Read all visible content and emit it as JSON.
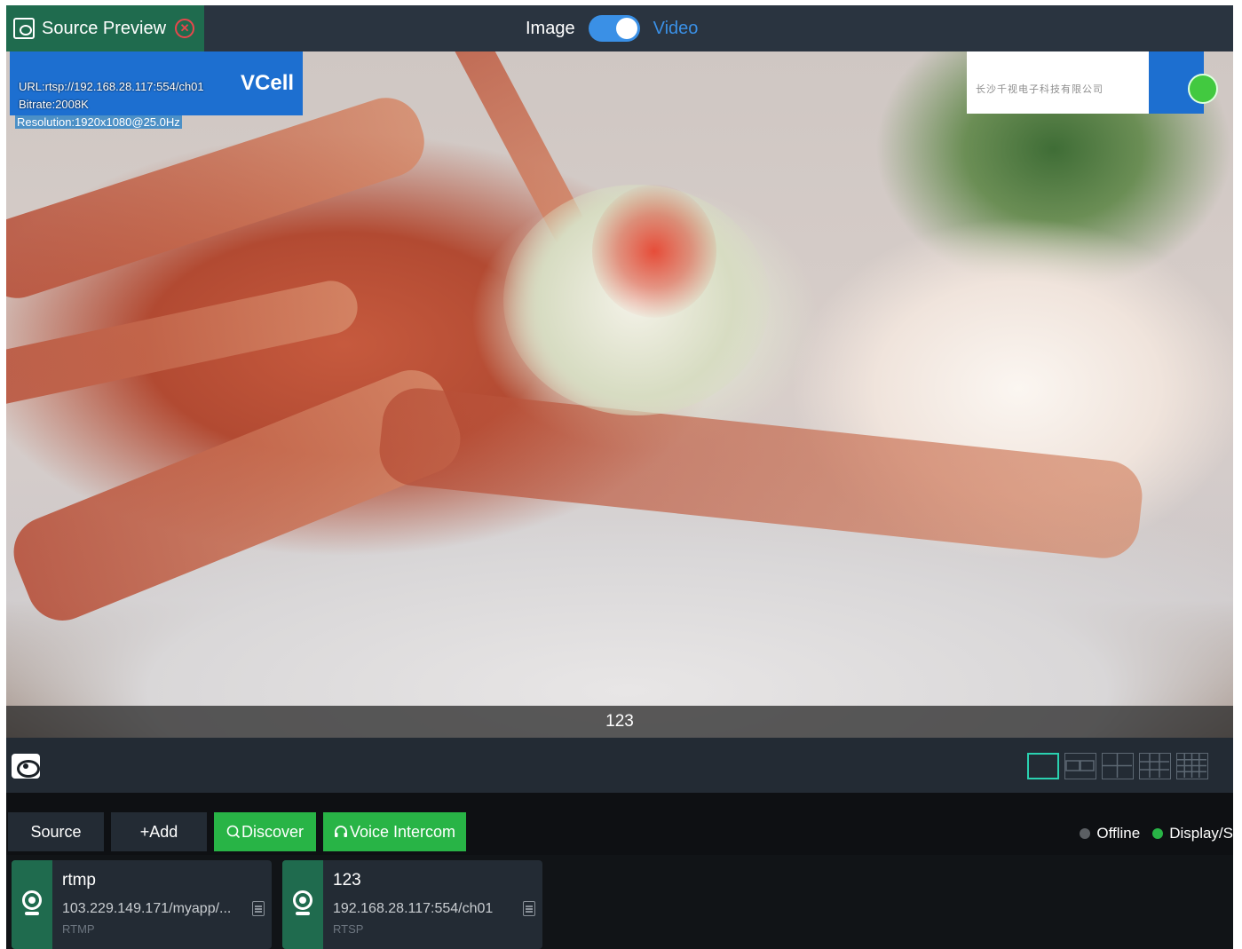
{
  "header": {
    "title": "Source Preview",
    "toggle_left": "Image",
    "toggle_right": "Video",
    "toggle_state": "Video"
  },
  "preview": {
    "overlay": {
      "url_line": "URL:rtsp://192.168.28.117:554/ch01",
      "bitrate_line": "Bitrate:2008K",
      "resolution_line": "Resolution:1920x1080@25.0Hz",
      "brand": "VCell"
    },
    "watermark_text": "长沙千视电子科技有限公司",
    "caption": "123"
  },
  "toolbar": {
    "layouts": [
      "1x1",
      "1x2",
      "2x2",
      "3x3",
      "4x4"
    ],
    "active_layout": "1x1"
  },
  "source_bar": {
    "source_label": "Source",
    "add_label": "+Add",
    "discover_label": "Discover",
    "voice_label": "Voice Intercom",
    "legend": [
      {
        "label": "Offline",
        "color": "#5b5f63"
      },
      {
        "label": "Display/S",
        "color": "#28b446"
      }
    ]
  },
  "cards": [
    {
      "name": "rtmp",
      "url": "103.229.149.171/myapp/...",
      "protocol": "RTMP"
    },
    {
      "name": "123",
      "url": "192.168.28.117:554/ch01",
      "protocol": "RTSP"
    }
  ],
  "colors": {
    "accent_green": "#28b446",
    "header_green": "#1f6b4e",
    "toggle_blue": "#3a90e6",
    "panel": "#232b34",
    "close_red": "#e8474c"
  }
}
